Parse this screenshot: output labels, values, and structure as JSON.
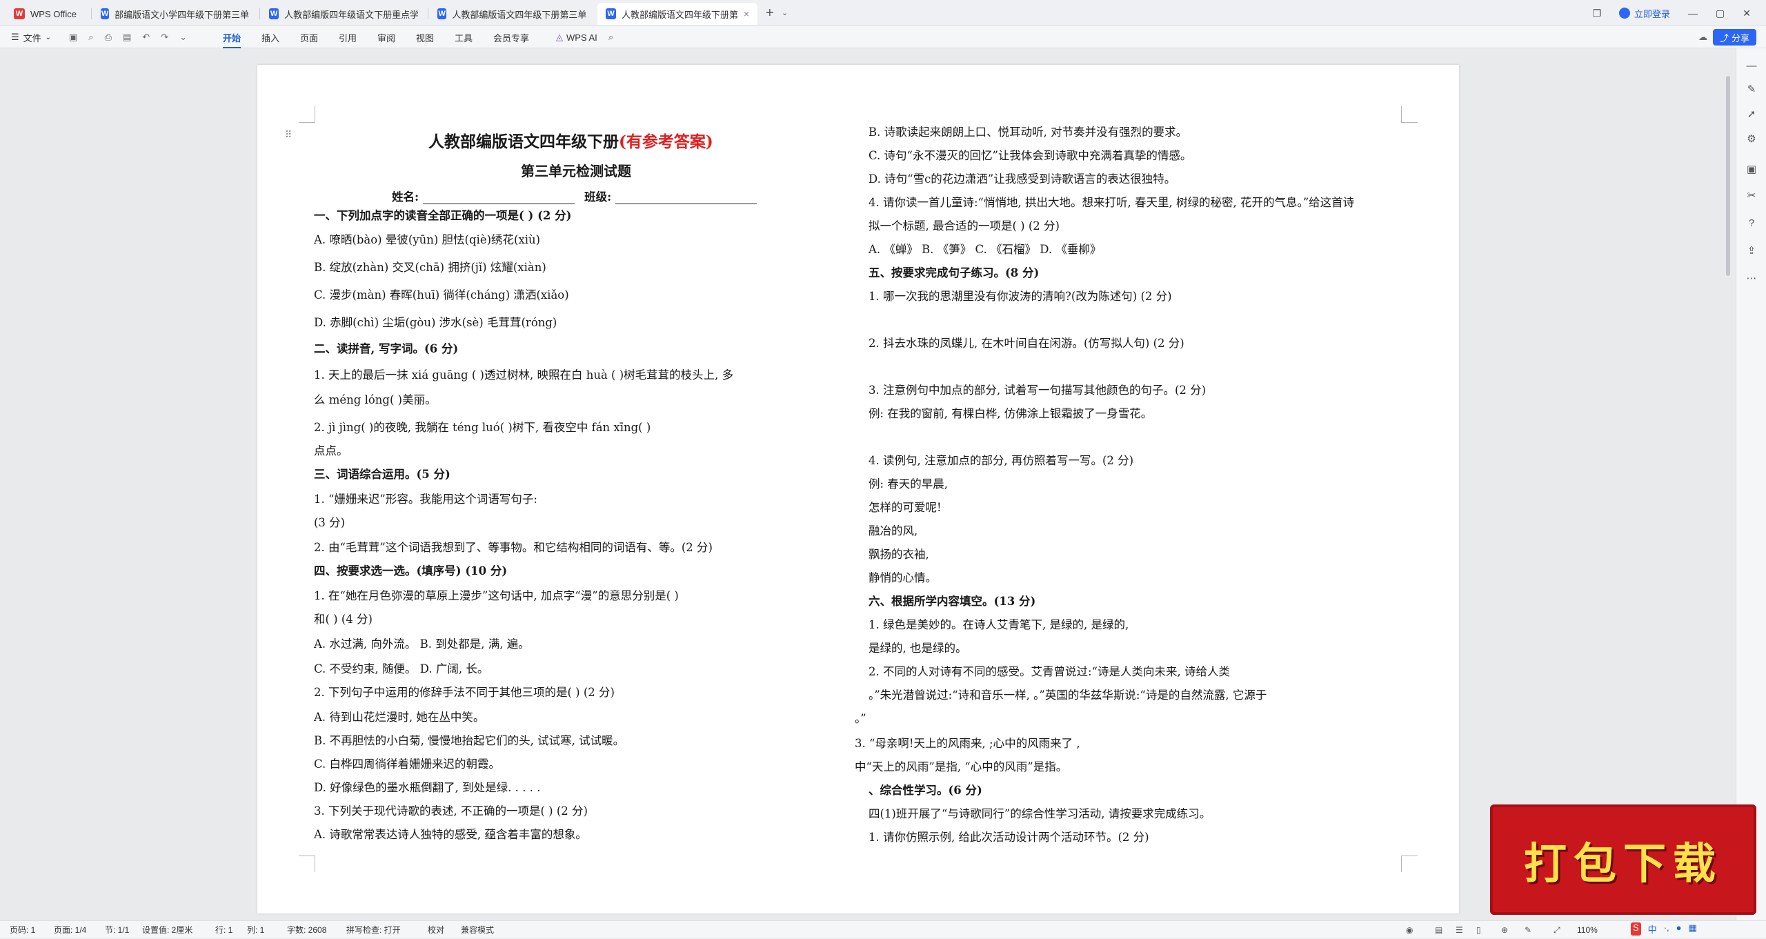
{
  "tabs": [
    {
      "label": "WPS Office",
      "type": "k"
    },
    {
      "label": "部编版语文小学四年级下册第三单元测试卷...",
      "type": "w"
    },
    {
      "label": "人教部编版四年级语文下册重点学校...",
      "type": "w"
    },
    {
      "label": "人教部编版语文四年级下册第三单元检...",
      "type": "w"
    },
    {
      "label": "人教部编版语文四年级下册第...",
      "type": "w"
    }
  ],
  "title_login": "立即登录",
  "menu": {
    "file": "文件",
    "tabs": [
      "开始",
      "插入",
      "页面",
      "引用",
      "审阅",
      "视图",
      "工具",
      "会员专享"
    ],
    "ai": "WPS AI",
    "share": "分享"
  },
  "doc": {
    "title_main": "人教部编版语文四年级下册",
    "title_red": "(有参考答案)",
    "subtitle": "第三单元检测试题",
    "name_label": "姓名:",
    "class_label": "班级:",
    "left": [
      {
        "t": "一、下列加点字的读音全部正确的一项是(        ) (2 分)",
        "b": true
      },
      {
        "t": "A. 嘹晒(bào)  晕彼(yūn)        胆怯(qiè)绣花(xiù)"
      },
      {
        "t": "B. 绽放(zhàn)      交叉(chā)        拥挤(jǐ)    炫耀(xiàn)"
      },
      {
        "t": "C. 漫步(màn)        春晖(huī)     徜徉(cháng)     潇洒(xiǎo)"
      },
      {
        "t": "D. 赤脚(chì)            尘垢(gòu)    涉水(sè)          毛茸茸(róng)"
      },
      {
        "t": "二、读拼音, 写字词。(6 分)",
        "b": true
      },
      {
        "t": "1. 天上的最后一抹 xiá  guāng (            )透过树林, 映照在白 huà (        )树毛茸茸的枝头上, 多"
      },
      {
        "t": "    么 méng  lóng(            )美丽。"
      },
      {
        "t": "2.  jì  jìng(            )的夜晚, 我躺在 téng luó(            )树下, 看夜空中 fán    xīng(            )"
      },
      {
        "t": "    点点。"
      },
      {
        "t": "三、词语综合运用。(5 分)",
        "b": true
      },
      {
        "t": "1. “姗姗来迟”形容。我能用这个词语写句子:"
      },
      {
        "t": " (3 分)"
      },
      {
        "t": "2. 由“毛茸茸”这个词语我想到了、等事物。和它结构相同的词语有、等。(2 分)"
      },
      {
        "t": "四、按要求选一选。(填序号) (10 分)",
        "b": true
      },
      {
        "t": "1. 在“她在月色弥漫的草原上漫步”这句话中, 加点字“漫”的意思分别是(          )"
      },
      {
        "t": "和(          ) (4 分)"
      },
      {
        "t": "A. 水过满, 向外流。                                             B. 到处都是, 满, 遍。"
      },
      {
        "t": "C. 不受约束, 随便。                                             D. 广阔, 长。"
      },
      {
        "t": "2. 下列句子中运用的修辞手法不同于其他三项的是(          ) (2 分)"
      },
      {
        "t": "A. 待到山花烂漫时, 她在丛中笑。"
      },
      {
        "t": "B. 不再胆怯的小白菊, 慢慢地抬起它们的头, 试试寒, 试试暖。"
      },
      {
        "t": "C. 白桦四周徜徉着姗姗来迟的朝霞。"
      },
      {
        "t": "D. 好像绿色的墨水瓶倒翻了, 到处是绿. . . . ."
      },
      {
        "t": "3. 下列关于现代诗歌的表述, 不正确的一项是(          ) (2 分)"
      },
      {
        "t": "A. 诗歌常常表达诗人独特的感受, 蕴含着丰富的想象。"
      }
    ],
    "right": [
      {
        "t": "B. 诗歌读起来朗朗上口、悦耳动听, 对节奏并没有强烈的要求。"
      },
      {
        "t": "C. 诗句“永不漫灭的回忆”让我体会到诗歌中充满着真挚的情感。"
      },
      {
        "t": "D. 诗句“雪с的花边潇洒”让我感受到诗歌语言的表达很独特。"
      },
      {
        "t": "4. 请你读一首儿童诗:“悄悄地, 拱出大地。想来打听, 春天里, 树绿的秘密, 花开的气息。”给这首诗"
      },
      {
        "t": "拟一个标题, 最合适的一项是(        ) (2 分)"
      },
      {
        "t": "A. 《蝉》            B. 《笋》            C. 《石榴》            D. 《垂柳》"
      },
      {
        "t": "五、按要求完成句子练习。(8 分)",
        "b": true
      },
      {
        "t": "1. 哪一次我的思潮里没有你波涛的清响?(改为陈述句) (2 分)"
      },
      {
        "t": ""
      },
      {
        "t": "2. 抖去水珠的凤蝶儿, 在木叶间自在闲游。(仿写拟人句) (2 分)"
      },
      {
        "t": ""
      },
      {
        "t": "3. 注意例句中加点的部分, 试着写一句描写其他颜色的句子。(2 分)"
      },
      {
        "t": "例: 在我的窗前, 有棵白桦, 仿佛涂上银霜披了一身雪花。"
      },
      {
        "t": ""
      },
      {
        "t": "4. 读例句, 注意加点的部分, 再仿照着写一写。(2 分)"
      },
      {
        "t": "例: 春天的早晨,"
      },
      {
        "t": "    怎样的可爱呢!"
      },
      {
        "t": "    融冶的风,"
      },
      {
        "t": "    飘扬的衣袖,"
      },
      {
        "t": "    静悄的心情。"
      },
      {
        "t": "六、根据所学内容填空。(13 分)",
        "b": true
      },
      {
        "t": "1. 绿色是美妙的。在诗人艾青笔下, 是绿的, 是绿的,"
      },
      {
        "t": " 是绿的, 也是绿的。"
      },
      {
        "t": "2. 不同的人对诗有不同的感受。艾青曾说过:“诗是人类向未来, 诗给人类"
      },
      {
        "t": "。”朱光潜曾说过:“诗和音乐一样, 。”英国的华兹华斯说:“诗是的自然流露, 它源于"
      },
      {
        "t": "。”"
      },
      {
        "t": "3.  “母亲啊!天上的风雨来, ;心中的风雨来了 ,"
      },
      {
        "t": "中“天上的风雨”是指, “心中的风雨”是指。"
      },
      {
        "t": "、综合性学习。(6 分)",
        "b": true
      },
      {
        "t": "  四(1)班开展了“与诗歌同行”的综合性学习活动, 请按要求完成练习。"
      },
      {
        "t": "1. 请你仿照示例, 给此次活动设计两个活动环节。(2 分)"
      }
    ]
  },
  "status": {
    "page": "页码: 1",
    "pages": "页面: 1/4",
    "section": "节: 1/1",
    "setting": "设置值: 2厘米",
    "row": "行: 1",
    "col": "列: 1",
    "words": "字数: 2608",
    "spell": "拼写检查: 打开",
    "proof": "校对",
    "compat": "兼容模式",
    "zoom": "110%"
  },
  "banner": "打包下载",
  "ime": [
    "中",
    "·,",
    "🎤",
    "▦",
    "▦",
    "▦"
  ]
}
